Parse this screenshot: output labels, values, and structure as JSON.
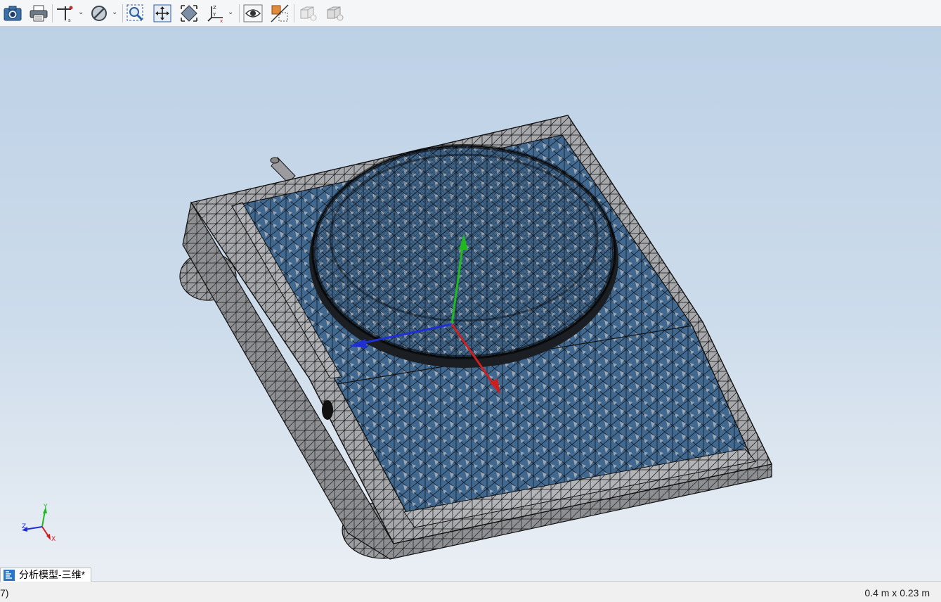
{
  "toolbar": {
    "buttons": [
      {
        "name": "screenshot-button",
        "icon": "camera-icon"
      },
      {
        "name": "print-button",
        "icon": "printer-icon"
      },
      {
        "name": "section-tool-button",
        "icon": "axis-probe-icon",
        "dropdown": true
      },
      {
        "name": "display-filter-button",
        "icon": "no-sign-icon",
        "dropdown": true
      },
      {
        "name": "zoom-window-button",
        "icon": "zoom-box-icon"
      },
      {
        "name": "pan-button",
        "icon": "pan-arrows-icon"
      },
      {
        "name": "fit-all-button",
        "icon": "fit-diamond-icon"
      },
      {
        "name": "view-orientation-button",
        "icon": "axis-triad-icon",
        "dropdown": true
      },
      {
        "name": "show-hide-button",
        "icon": "eye-icon"
      },
      {
        "name": "section-plane-button",
        "icon": "section-plane-icon"
      },
      {
        "name": "light-box-button",
        "icon": "lit-box-icon"
      },
      {
        "name": "light-box-2-button",
        "icon": "lit-box-icon-2"
      }
    ]
  },
  "viewport": {
    "colors": {
      "background_top": "#bdd1e6",
      "background_bottom": "#e9eef4",
      "mesh_face": "#a9aaae",
      "mesh_fill_blue": "#3f6791",
      "axis_x": "#cc1f1f",
      "axis_y": "#1fb81f",
      "axis_z": "#1f2fd6"
    },
    "triad_labels": {
      "x": "X",
      "y": "Y",
      "z": "Z"
    }
  },
  "tab": {
    "label": "分析模型-三维*",
    "icon": "model-tree-icon"
  },
  "status": {
    "left_text": "7)",
    "dimensions": "0.4 m x 0.23 m"
  }
}
